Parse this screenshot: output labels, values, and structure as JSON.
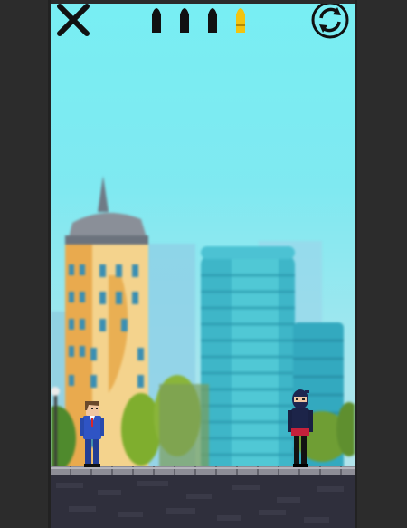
{
  "game": {
    "ammo": {
      "total": 4,
      "states": [
        "loaded",
        "loaded",
        "loaded",
        "active"
      ],
      "colors": {
        "loaded": "#111111",
        "active": "#f2c40f"
      }
    },
    "controls": {
      "close_icon": "close-icon",
      "restart_icon": "restart-icon"
    },
    "scene": {
      "background": "city-skyline",
      "sky_color": "#7fe9f1",
      "ground_color": "#2f2f3c",
      "player": "agent-in-blue-suit",
      "enemy": "ninja"
    }
  }
}
